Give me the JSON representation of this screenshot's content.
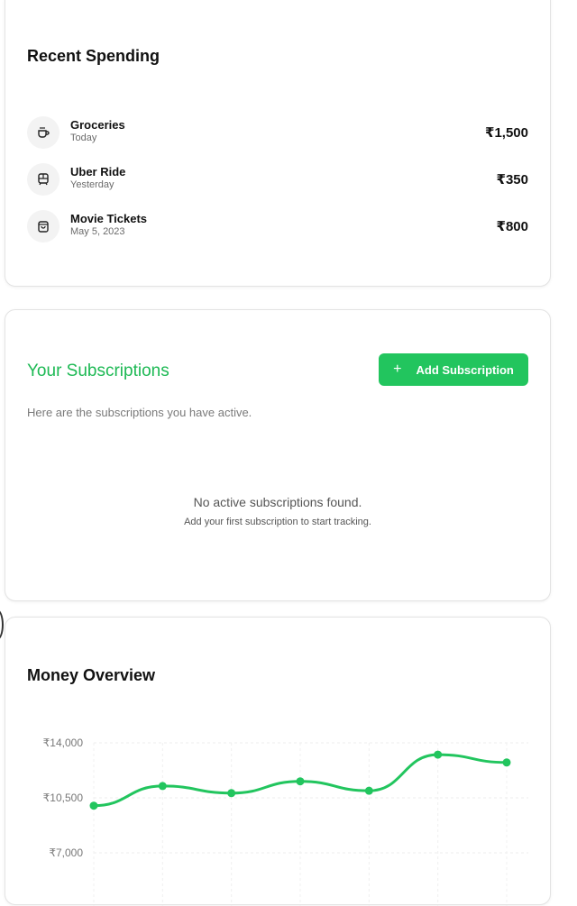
{
  "recent_spending": {
    "title": "Recent Spending",
    "items": [
      {
        "icon": "coffee-cup-icon",
        "name": "Groceries",
        "date": "Today",
        "amount": "₹1,500"
      },
      {
        "icon": "bus-icon",
        "name": "Uber Ride",
        "date": "Yesterday",
        "amount": "₹350"
      },
      {
        "icon": "shopping-bag-icon",
        "name": "Movie Tickets",
        "date": "May 5, 2023",
        "amount": "₹800"
      }
    ]
  },
  "subscriptions": {
    "title": "Your Subscriptions",
    "add_button_label": "Add Subscription",
    "add_button_icon": "plus-icon",
    "description": "Here are the subscriptions you have active.",
    "empty_title": "No active subscriptions found.",
    "empty_subtitle": "Add your first subscription to start tracking."
  },
  "money_overview": {
    "title": "Money Overview"
  },
  "colors": {
    "accent": "#22c55e",
    "accent_text": "#1db954"
  },
  "chart_data": {
    "type": "line",
    "title": "Money Overview",
    "y_tick_labels": [
      "₹14,000",
      "₹10,500",
      "₹7,000"
    ],
    "y_ticks": [
      14000,
      10500,
      7000
    ],
    "ylim": [
      7000,
      14000
    ],
    "grid": true,
    "series": [
      {
        "values": [
          10000,
          11250,
          10800,
          11550,
          10950,
          13250,
          12750
        ]
      }
    ]
  }
}
